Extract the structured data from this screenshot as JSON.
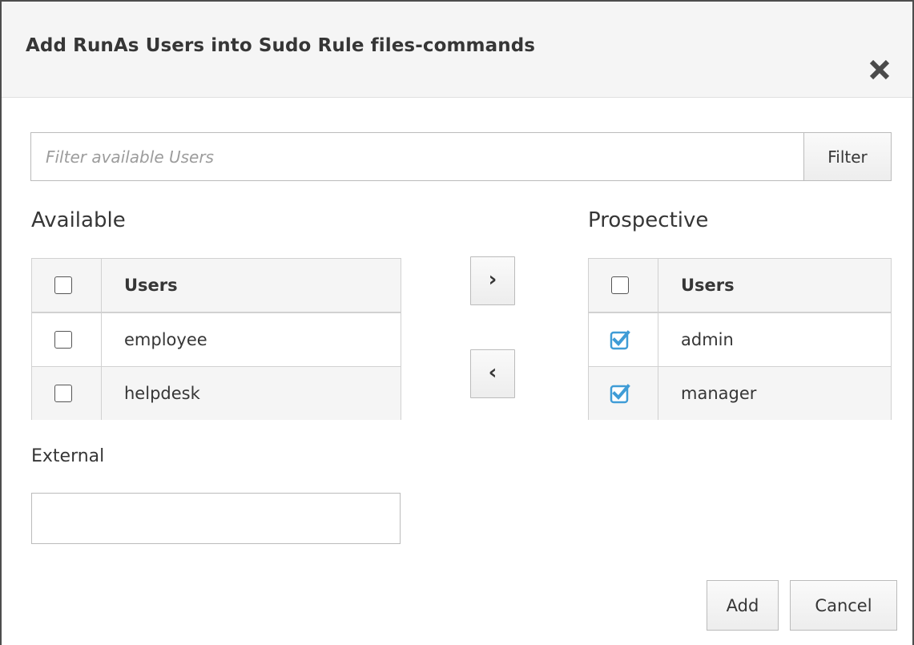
{
  "dialog": {
    "title": "Add RunAs Users into Sudo Rule files-commands",
    "close_icon": "close-icon"
  },
  "filter": {
    "placeholder": "Filter available Users",
    "value": "",
    "button_label": "Filter"
  },
  "available": {
    "label": "Available",
    "header": "Users",
    "rows": [
      {
        "name": "employee",
        "checked": false
      },
      {
        "name": "helpdesk",
        "checked": false
      }
    ]
  },
  "prospective": {
    "label": "Prospective",
    "header": "Users",
    "rows": [
      {
        "name": "admin",
        "checked": true
      },
      {
        "name": "manager",
        "checked": true
      }
    ]
  },
  "move": {
    "right_icon": "chevron-right-icon",
    "left_icon": "chevron-left-icon",
    "right_glyph": "›",
    "left_glyph": "‹"
  },
  "external": {
    "label": "External",
    "value": ""
  },
  "actions": {
    "add_label": "Add",
    "cancel_label": "Cancel"
  },
  "colors": {
    "checkbox_checked": "#3f9cd6",
    "header_bg": "#f5f5f5",
    "border": "#d1d1d1"
  }
}
